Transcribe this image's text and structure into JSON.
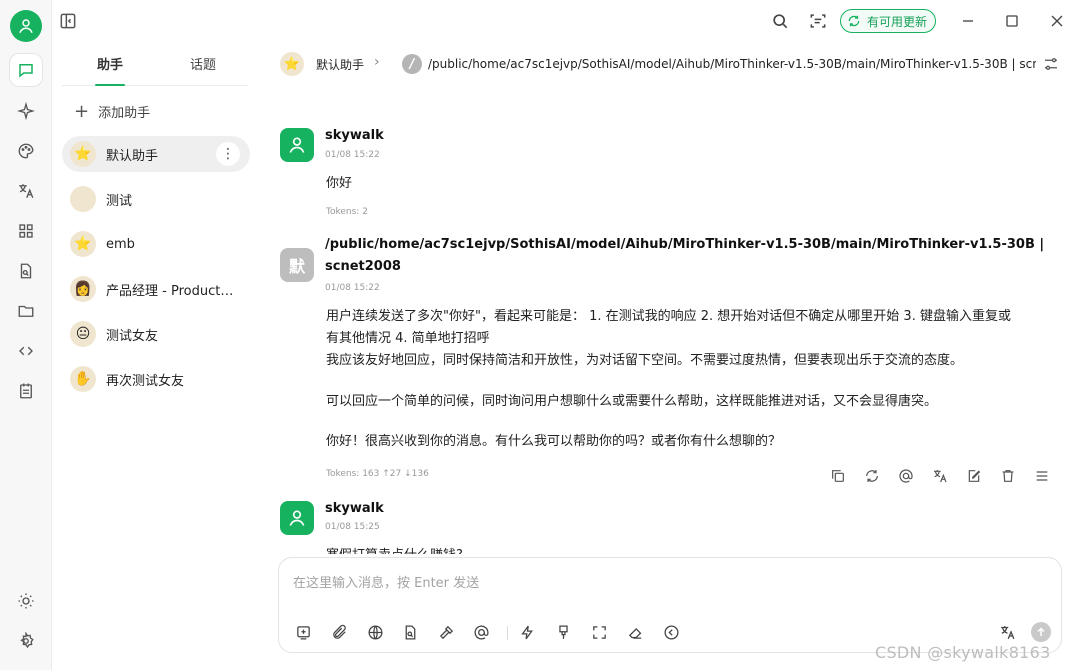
{
  "topbar": {
    "update_label": "有可用更新"
  },
  "panel": {
    "tabs": [
      "助手",
      "话题"
    ],
    "add_label": "添加助手",
    "assistants": [
      {
        "label": "默认助手",
        "emoji": "⭐"
      },
      {
        "label": "测试",
        "emoji": ""
      },
      {
        "label": "emb",
        "emoji": "⭐"
      },
      {
        "label": "产品经理 - Product…",
        "emoji": "👩"
      },
      {
        "label": "测试女友",
        "emoji": "😐"
      },
      {
        "label": "再次测试女友",
        "emoji": "✋"
      }
    ]
  },
  "header": {
    "assistant_name": "默认助手",
    "model_path": "/public/home/ac7sc1ejvp/SothisAI/model/Aihub/MiroThinker-v1.5-30B/main/MiroThinker-v1.5-30B | scnet2008"
  },
  "messages": [
    {
      "author": "skywalk",
      "time": "01/08 15:22",
      "text": "你好",
      "tokens": "Tokens: 2"
    },
    {
      "author_line1": "/public/home/ac7sc1ejvp/SothisAI/model/Aihub/MiroThinker-v1.5-30B/main/MiroThinker-v1.5-30B |",
      "author_line2": "scnet2008",
      "avatar_text": "默",
      "time": "01/08 15:22",
      "thinking_line1": "用户连续发送了多次\"你好\"，看起来可能是： 1. 在测试我的响应 2. 想开始对话但不确定从哪里开始 3. 键盘输入重复或",
      "thinking_line2": "有其他情况 4. 简单地打招呼",
      "thinking_line3": "我应该友好地回应，同时保持简洁和开放性，为对话留下空间。不需要过度热情，但要表现出乐于交流的态度。",
      "para2": "可以回应一个简单的问候，同时询问用户想聊什么或需要什么帮助，这样既能推进对话，又不会显得唐突。",
      "para3": "你好！很高兴收到你的消息。有什么我可以帮助你的吗？或者你有什么想聊的？",
      "tokens": "Tokens: 163 ↑27 ↓136"
    },
    {
      "author": "skywalk",
      "time": "01/08 15:25",
      "text": "寒假打算卖点什么赚钱?"
    }
  ],
  "input": {
    "placeholder": "在这里输入消息，按 Enter 发送"
  },
  "watermark": "CSDN @skywalk8163",
  "colors": {
    "accent": "#16b25f",
    "model_avatar": "#bdbdbd"
  }
}
